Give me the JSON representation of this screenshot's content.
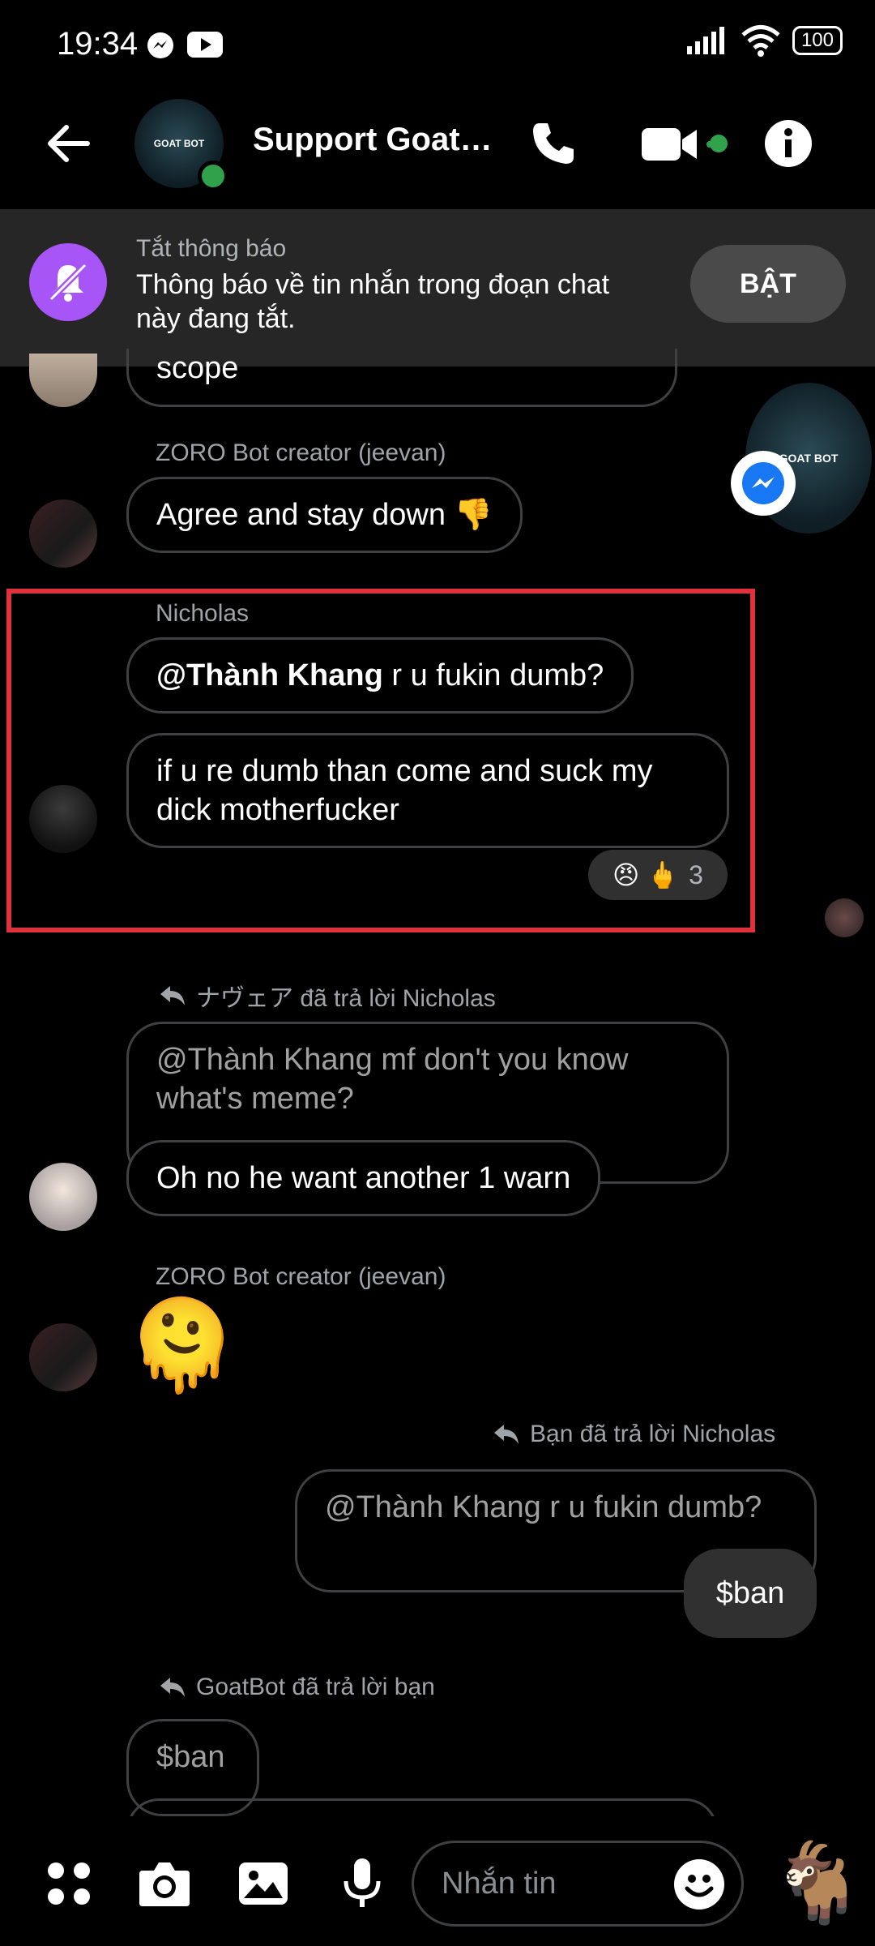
{
  "status_bar": {
    "time": "19:34",
    "battery": "100"
  },
  "header": {
    "title": "Support GoatB...",
    "group_avatar_text": "GOAT BOT"
  },
  "mute_banner": {
    "title": "Tắt thông báo",
    "body": "Thông báo về tin nhắn trong đoạn chat này đang tắt.",
    "button": "BẬT"
  },
  "messages": {
    "m0_partial": "scope",
    "zoro_name": "ZORO Bot creator (jeevan)",
    "m1": "Agree and stay down 👎",
    "nicholas_name": "Nicholas",
    "m2_mention": "@Thành Khang",
    "m2_rest": " r u fukin dumb?",
    "m3": "if u re dumb than come and suck my dick motherfucker",
    "reaction_emojis": "😠 🖕",
    "reaction_count": "3",
    "reply1_label": "ナヴェア đã trả lời Nicholas",
    "reply1_quoted": "@Thành Khang mf don't you know what's meme?",
    "m4": "Oh no he want another 1 warn",
    "zoro_name2": "ZORO Bot creator (jeevan)",
    "m5_emoji": "🫠",
    "reply2_label": "Bạn đã trả lời Nicholas",
    "reply2_quoted": "@Thành Khang r u fukin dumb?",
    "m6": "$ban",
    "reply3_label": "GoatBot đã trả lời bạn",
    "reply3_quoted": "$ban"
  },
  "floating_head": {
    "text": "GOAT BOT"
  },
  "composer": {
    "placeholder": "Nhắn tin",
    "goat_emoji": "🐐"
  }
}
